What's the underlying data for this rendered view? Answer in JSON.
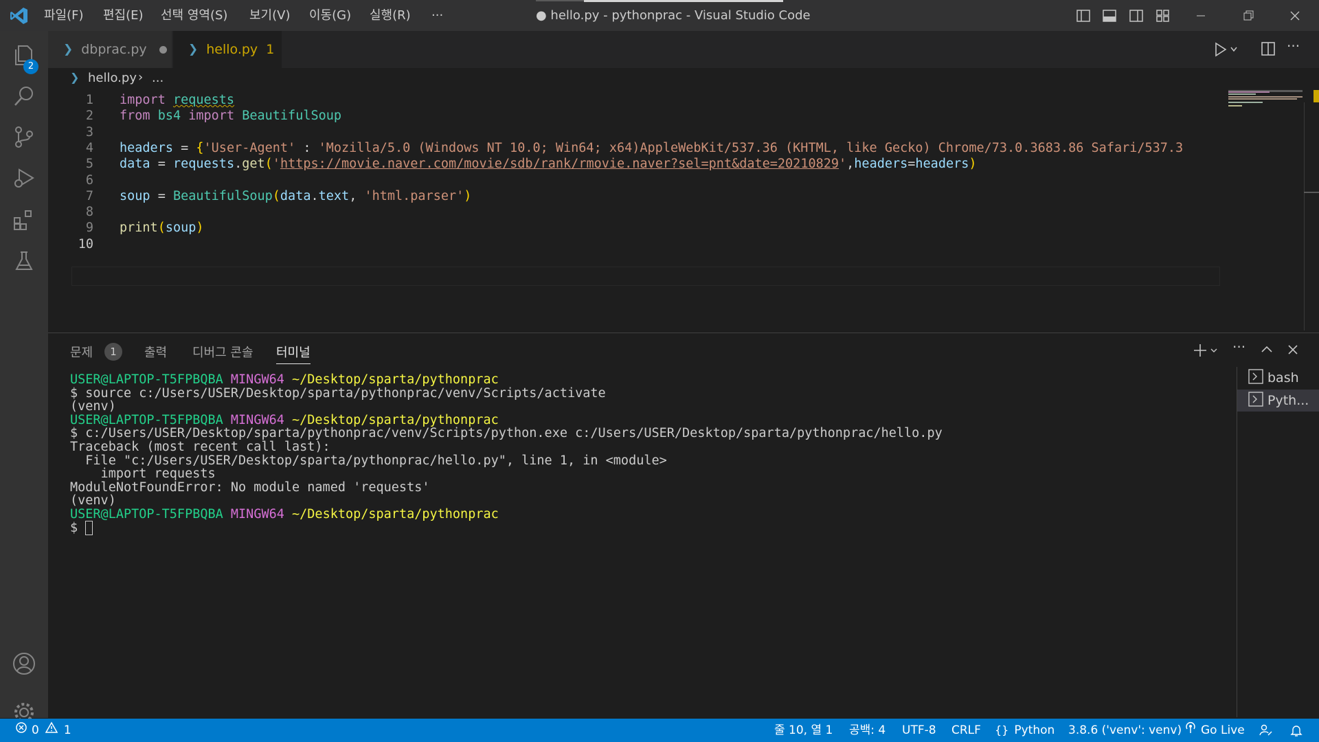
{
  "window": {
    "title": "● hello.py - pythonprac - Visual Studio Code",
    "menu": [
      "파일(F)",
      "편집(E)",
      "선택 영역(S)",
      "보기(V)",
      "이동(G)",
      "실행(R)",
      "···"
    ]
  },
  "activity_bar": {
    "explorer_badge": "2"
  },
  "tabs": [
    {
      "label": "dbprac.py",
      "modified": true
    },
    {
      "label": "hello.py",
      "problems": "1",
      "modified": true,
      "active": true
    }
  ],
  "breadcrumb": {
    "file": "hello.py",
    "rest": "..."
  },
  "editor": {
    "line_numbers": [
      "1",
      "2",
      "3",
      "4",
      "5",
      "6",
      "7",
      "8",
      "9",
      "10"
    ],
    "current_line": "10",
    "lines": [
      "import requests",
      "from bs4 import BeautifulSoup",
      "",
      "headers = {'User-Agent' : 'Mozilla/5.0 (Windows NT 10.0; Win64; x64)AppleWebKit/537.36 (KHTML, like Gecko) Chrome/73.0.3683.86 Safari/537.3",
      "data = requests.get('https://movie.naver.com/movie/sdb/rank/rmovie.naver?sel=pnt&date=20210829',headers=headers)",
      "",
      "soup = BeautifulSoup(data.text, 'html.parser')",
      "",
      "print(soup)",
      ""
    ]
  },
  "panel": {
    "tabs": [
      {
        "label": "문제",
        "badge": "1"
      },
      {
        "label": "출력"
      },
      {
        "label": "디버그 콘솔"
      },
      {
        "label": "터미널",
        "active": true
      }
    ],
    "terminal_lines": [
      {
        "user": "USER@LAPTOP-T5FPBQBA",
        "host": "MINGW64",
        "path": "~/Desktop/sparta/pythonprac"
      },
      {
        "text": "$ source c:/Users/USER/Desktop/sparta/pythonprac/venv/Scripts/activate"
      },
      {
        "text": "(venv)"
      },
      {
        "user": "USER@LAPTOP-T5FPBQBA",
        "host": "MINGW64",
        "path": "~/Desktop/sparta/pythonprac"
      },
      {
        "text": "$ c:/Users/USER/Desktop/sparta/pythonprac/venv/Scripts/python.exe c:/Users/USER/Desktop/sparta/pythonprac/hello.py"
      },
      {
        "text": "Traceback (most recent call last):"
      },
      {
        "text": "  File \"c:/Users/USER/Desktop/sparta/pythonprac/hello.py\", line 1, in <module>"
      },
      {
        "text": "    import requests"
      },
      {
        "text": "ModuleNotFoundError: No module named 'requests'"
      },
      {
        "text": "(venv)"
      },
      {
        "user": "USER@LAPTOP-T5FPBQBA",
        "host": "MINGW64",
        "path": "~/Desktop/sparta/pythonprac"
      },
      {
        "text": "$ "
      }
    ],
    "terminal_instances": [
      "bash",
      "Pyth..."
    ]
  },
  "status_bar": {
    "errors": "0",
    "warnings": "1",
    "position": "줄 10, 열 1",
    "indent": "공백: 4",
    "encoding": "UTF-8",
    "eol": "CRLF",
    "language": "Python",
    "interpreter": "3.8.6 ('venv': venv)",
    "go_live": "Go Live"
  },
  "colors": {
    "accent": "#007acc",
    "terminal_green": "#23d18b",
    "terminal_magenta": "#d670d6",
    "terminal_yellow": "#f5f543"
  }
}
